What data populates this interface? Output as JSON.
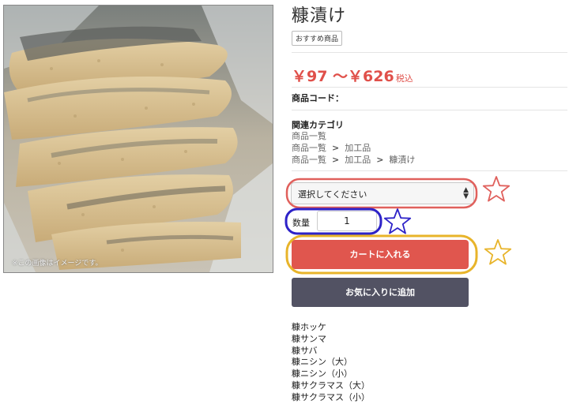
{
  "product": {
    "title": "糠漬け",
    "badge": "おすすめ商品",
    "price_text": "￥97 ～￥626",
    "tax_label": "税込",
    "code_label": "商品コード：",
    "image_note": "※この画像はイメージです。"
  },
  "categories": {
    "title": "関連カテゴリ",
    "paths": [
      [
        "商品一覧"
      ],
      [
        "商品一覧",
        "加工品"
      ],
      [
        "商品一覧",
        "加工品",
        "糠漬け"
      ]
    ],
    "separator": ">"
  },
  "form": {
    "select_value": "選択してください",
    "qty_label": "数量",
    "qty_value": "1",
    "cart_button": "カートに入れる",
    "fav_button": "お気に入りに追加"
  },
  "related_items": [
    "糠ホッケ",
    "糠サンマ",
    "糠サバ",
    "糠ニシン（大）",
    "糠ニシン（小）",
    "糠サクラマス（大）",
    "糠サクラマス（小）"
  ],
  "annotation_colors": {
    "red": "#e0605c",
    "blue": "#2d22c8",
    "gold": "#e8b42a"
  }
}
